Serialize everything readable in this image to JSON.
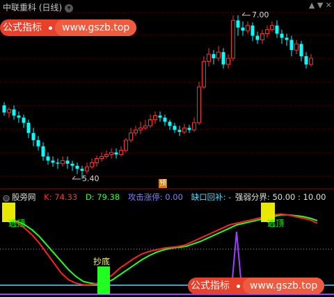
{
  "header": {
    "title": "中联重科 (日线)",
    "controls": "▲ ▼ ✕"
  },
  "badges": {
    "label": "公式指标",
    "url": "www.gszb.top"
  },
  "price_chart": {
    "high_label": "7.00",
    "low_label": "5.40",
    "yu_marker": "预"
  },
  "indicator": {
    "name": "股旁网",
    "k_label": "K: 74.33",
    "d_label": "D: 79.38",
    "attack_label": "攻击涨停: 0.00",
    "gap_label": "缺口回补: -",
    "strength_label": "强弱分界: 50.00",
    "ten_label": ": 10.00",
    "signal_top_left": "逃顶",
    "signal_bottom": "抄底",
    "signal_top_right": "逃顶"
  },
  "colors": {
    "up": "#ff3030",
    "down": "#00ffff",
    "k_line": "#ff2020",
    "d_line": "#20ff20",
    "grid": "#8b0000"
  }
}
